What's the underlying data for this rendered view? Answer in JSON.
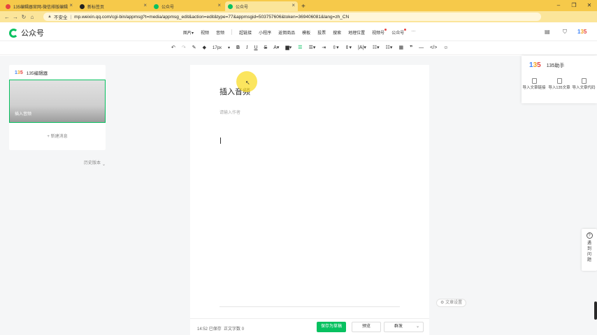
{
  "browser": {
    "tabs": [
      {
        "title": "135编辑器官网-微信排版编辑",
        "active": false,
        "favicon_color": "#e64340"
      },
      {
        "title": "新标签页",
        "active": false,
        "favicon_color": "#222222"
      },
      {
        "title": "公众号",
        "active": false,
        "favicon_color": "#07c160"
      },
      {
        "title": "公众号",
        "active": true,
        "favicon_color": "#07c160"
      }
    ],
    "new_tab": "+",
    "security": "不安全",
    "url": "mp.weixin.qq.com/cgi-bin/appmsg?t=media/appmsg_edit&action=edit&type=77&appmsgid=503757606&token=369406081&lang=zh_CN",
    "update_label": "更新"
  },
  "app": {
    "brand": "公众号",
    "menu": [
      {
        "label": "图片",
        "dot": false
      },
      {
        "label": "视频",
        "dot": false
      },
      {
        "label": "音频",
        "dot": false
      },
      {
        "label": "超链接",
        "dot": false
      },
      {
        "label": "小程序",
        "dot": false
      },
      {
        "label": "返佣商品",
        "dot": false
      },
      {
        "label": "模板",
        "dot": false
      },
      {
        "label": "投票",
        "dot": false
      },
      {
        "label": "搜索",
        "dot": false
      },
      {
        "label": "地理位置",
        "dot": false
      },
      {
        "label": "视频号",
        "dot": true
      },
      {
        "label": "公众号",
        "dot": true
      }
    ],
    "more": "···",
    "header_badge": "135",
    "font_size": "17px"
  },
  "left_panel": {
    "brand": "135编辑器",
    "article_title": "插入音频",
    "new_message": "+ 新建消息",
    "history": "历史版本"
  },
  "editor": {
    "title": "插入音频",
    "author_placeholder": "请输入作者"
  },
  "bottom_bar": {
    "save_time": "14:52",
    "saved": "已保存",
    "word_count_label": "正文字数",
    "word_count": "0",
    "save_draft": "保存为草稿",
    "preview": "预览",
    "publish": "群发"
  },
  "helper": {
    "title": "135助手",
    "items": [
      "导入文章链接",
      "导入135文章",
      "导入文章代码"
    ]
  },
  "article_settings": "文章设置",
  "help_widget": "遇到问题",
  "colors": {
    "brand_green": "#07c160",
    "chrome_yellow": "#f6c94a",
    "alert_red": "#e64340"
  }
}
